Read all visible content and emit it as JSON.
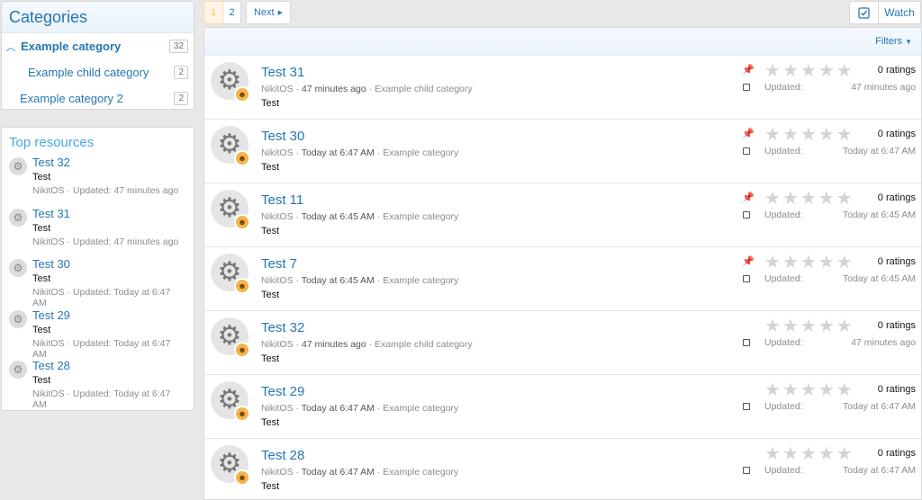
{
  "categories": {
    "title": "Categories",
    "items": [
      {
        "label": "Example category",
        "count": "32"
      },
      {
        "label": "Example child category",
        "count": "2"
      },
      {
        "label": "Example category 2",
        "count": "2"
      }
    ]
  },
  "top_resources": {
    "title": "Top resources",
    "items": [
      {
        "title": "Test 32",
        "tagline": "Test",
        "meta": "NikitOS · Updated: 47 minutes ago"
      },
      {
        "title": "Test 31",
        "tagline": "Test",
        "meta": "NikitOS · Updated: 47 minutes ago"
      },
      {
        "title": "Test 30",
        "tagline": "Test",
        "meta": "NikitOS · Updated: Today at 6:47 AM"
      },
      {
        "title": "Test 29",
        "tagline": "Test",
        "meta": "NikitOS · Updated: Today at 6:47 AM"
      },
      {
        "title": "Test 28",
        "tagline": "Test",
        "meta": "NikitOS · Updated: Today at 6:47 AM"
      }
    ]
  },
  "pager": {
    "pages": [
      "1",
      "2"
    ],
    "current": "1",
    "next": "Next"
  },
  "watch": {
    "label": "Watch"
  },
  "filters": {
    "label": "Filters"
  },
  "resources": [
    {
      "title": "Test 31",
      "author": "NikitOS",
      "date": "47 minutes ago",
      "category": "Example child category",
      "tagline": "Test",
      "ratings": "0 ratings",
      "updated_label": "Updated:",
      "updated": "47 minutes ago",
      "pinned": true
    },
    {
      "title": "Test 30",
      "author": "NikitOS",
      "date": "Today at 6:47 AM",
      "category": "Example category",
      "tagline": "Test",
      "ratings": "0 ratings",
      "updated_label": "Updated:",
      "updated": "Today at 6:47 AM",
      "pinned": true
    },
    {
      "title": "Test 11",
      "author": "NikitOS",
      "date": "Today at 6:45 AM",
      "category": "Example category",
      "tagline": "Test",
      "ratings": "0 ratings",
      "updated_label": "Updated:",
      "updated": "Today at 6:45 AM",
      "pinned": true
    },
    {
      "title": "Test 7",
      "author": "NikitOS",
      "date": "Today at 6:45 AM",
      "category": "Example category",
      "tagline": "Test",
      "ratings": "0 ratings",
      "updated_label": "Updated:",
      "updated": "Today at 6:45 AM",
      "pinned": true
    },
    {
      "title": "Test 32",
      "author": "NikitOS",
      "date": "47 minutes ago",
      "category": "Example child category",
      "tagline": "Test",
      "ratings": "0 ratings",
      "updated_label": "Updated:",
      "updated": "47 minutes ago",
      "pinned": false
    },
    {
      "title": "Test 29",
      "author": "NikitOS",
      "date": "Today at 6:47 AM",
      "category": "Example category",
      "tagline": "Test",
      "ratings": "0 ratings",
      "updated_label": "Updated:",
      "updated": "Today at 6:47 AM",
      "pinned": false
    },
    {
      "title": "Test 28",
      "author": "NikitOS",
      "date": "Today at 6:47 AM",
      "category": "Example category",
      "tagline": "Test",
      "ratings": "0 ratings",
      "updated_label": "Updated:",
      "updated": "Today at 6:47 AM",
      "pinned": false
    }
  ],
  "icons": {
    "resource": "gear-icon",
    "user": "avatar-icon",
    "star": "star-icon",
    "pin": "pin-icon"
  },
  "colors": {
    "link": "#2577b1",
    "accent": "#47a7eb",
    "current_page": "#f9bc6d"
  }
}
